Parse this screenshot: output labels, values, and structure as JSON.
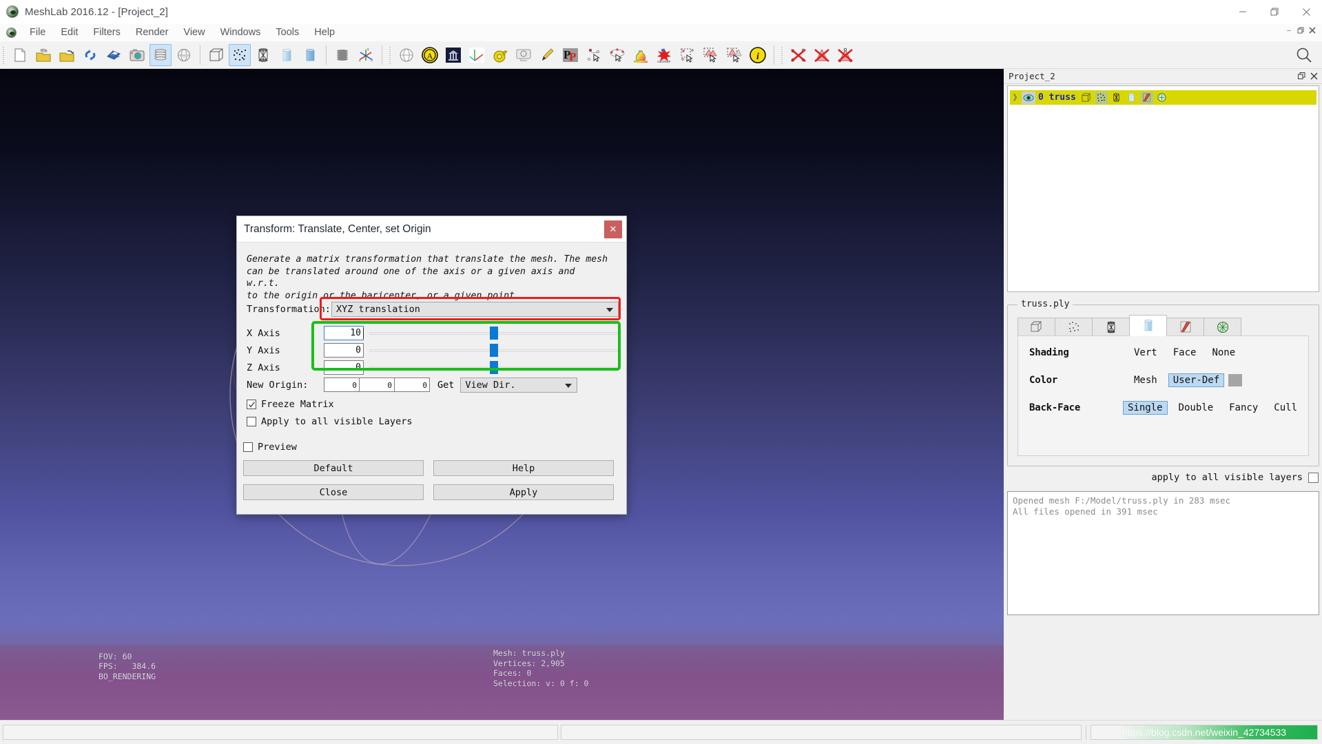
{
  "window": {
    "title": "MeshLab 2016.12 - [Project_2]",
    "logo_icon": "meshlab-logo-icon",
    "controls": [
      {
        "name": "minimize-button",
        "label": "—"
      },
      {
        "name": "restore-button",
        "label": "❐"
      },
      {
        "name": "close-button",
        "label": "✕"
      }
    ],
    "mdi_controls": [
      {
        "name": "mdi-minimize-button",
        "label": "–"
      },
      {
        "name": "mdi-restore-button",
        "label": "❐"
      },
      {
        "name": "mdi-close-button",
        "label": "✕"
      }
    ]
  },
  "menubar": {
    "items": [
      "File",
      "Edit",
      "Filters",
      "Render",
      "View",
      "Windows",
      "Tools",
      "Help"
    ]
  },
  "toolbar": {
    "groups": [
      {
        "name": "file-group",
        "buttons": [
          {
            "name": "new-project-icon",
            "checked": false
          },
          {
            "name": "open-project-icon",
            "checked": false
          },
          {
            "name": "open-mesh-icon",
            "checked": false
          },
          {
            "name": "reload-icon",
            "checked": false
          },
          {
            "name": "save-mesh-icon",
            "checked": false
          },
          {
            "name": "snapshot-icon",
            "checked": false
          },
          {
            "name": "show-layer-dialog-icon",
            "checked": true
          },
          {
            "name": "show-raster-layer-icon",
            "checked": false
          }
        ]
      },
      {
        "name": "render-group",
        "buttons": [
          {
            "name": "bounding-box-icon",
            "checked": false
          },
          {
            "name": "points-icon",
            "checked": true
          },
          {
            "name": "wireframe-icon",
            "checked": false
          },
          {
            "name": "flat-lines-icon",
            "checked": false
          },
          {
            "name": "smooth-icon",
            "checked": false
          },
          {
            "name": "texture-icon",
            "checked": false
          },
          {
            "name": "show-axis-icon",
            "checked": false
          }
        ]
      },
      {
        "name": "edit-group",
        "buttons": [
          {
            "name": "sphere-edit-icon",
            "checked": false
          },
          {
            "name": "align-icon",
            "checked": false
          },
          {
            "name": "z-painting-icon",
            "checked": false
          },
          {
            "name": "manipulators-icon",
            "checked": false
          },
          {
            "name": "measure-tool-icon",
            "checked": false
          },
          {
            "name": "raster-alignment-icon",
            "checked": false
          },
          {
            "name": "paint-brush-icon",
            "checked": false
          },
          {
            "name": "pick-points-icon",
            "checked": false
          },
          {
            "name": "select-vertexes-icon",
            "checked": false
          },
          {
            "name": "quality-mapper-icon",
            "checked": false
          },
          {
            "name": "georef-icon",
            "checked": false
          },
          {
            "name": "select-vertex-rubber-icon",
            "checked": false
          },
          {
            "name": "select-faces-icon",
            "checked": false
          },
          {
            "name": "select-connected-icon",
            "checked": false
          },
          {
            "name": "get-info-icon",
            "checked": false
          }
        ]
      },
      {
        "name": "delete-group",
        "buttons": [
          {
            "name": "delete-vertices-icon",
            "checked": false
          },
          {
            "name": "delete-faces-icon",
            "checked": false
          },
          {
            "name": "delete-faces-and-vertices-icon",
            "checked": false
          }
        ]
      }
    ],
    "search_icon": "search-icon"
  },
  "viewport": {
    "osd_left": "FOV: 60\nFPS:   384.6\nBO_RENDERING",
    "osd_mid": "Mesh: truss.ply\nVertices: 2,905\nFaces: 0\nSelection: v: 0 f: 0",
    "trackball_color": "#c9a8c4"
  },
  "dock": {
    "project_panel": {
      "title": "Project_2",
      "float_icon": "float-panel-icon",
      "close_icon": "close-panel-icon",
      "layers": [
        {
          "expand_icon": "chevron-right-icon",
          "visibility_icon": "eye-icon",
          "name": "0 truss",
          "icons": [
            {
              "name": "bounding-box-icon",
              "selected": false
            },
            {
              "name": "points-icon",
              "selected": true
            },
            {
              "name": "wireframe-icon",
              "selected": false
            },
            {
              "name": "flat-lines-icon",
              "selected": false
            },
            {
              "name": "smooth-icon",
              "selected": true
            },
            {
              "name": "texture-icon",
              "selected": false
            }
          ]
        }
      ]
    },
    "render_panel": {
      "group_label": "truss.ply",
      "tabs": [
        {
          "name": "tab-bounding-box",
          "icon": "bounding-box-icon",
          "active": false
        },
        {
          "name": "tab-points",
          "icon": "points-icon",
          "active": false
        },
        {
          "name": "tab-wireframe",
          "icon": "wireframe-icon",
          "active": false
        },
        {
          "name": "tab-solid",
          "icon": "smooth-cylinder-icon",
          "active": true
        },
        {
          "name": "tab-flat-lines",
          "icon": "flat-lines-icon",
          "active": false
        },
        {
          "name": "tab-texture",
          "icon": "texture-icon",
          "active": false
        }
      ],
      "rows": [
        {
          "label": "Shading",
          "options": [
            {
              "text": "Vert",
              "selected": false
            },
            {
              "text": "Face",
              "selected": false
            },
            {
              "text": "None",
              "selected": false
            }
          ]
        },
        {
          "label": "Color",
          "options": [
            {
              "text": "Mesh",
              "selected": false
            },
            {
              "text": "User-Def",
              "selected": true
            }
          ],
          "swatch": "#a5a5a5"
        },
        {
          "label": "Back-Face",
          "options": [
            {
              "text": "Single",
              "selected": true
            },
            {
              "text": "Double",
              "selected": false
            },
            {
              "text": "Fancy",
              "selected": false
            },
            {
              "text": "Cull",
              "selected": false
            }
          ]
        }
      ],
      "apply_all_label": "apply to all visible layers",
      "apply_all_checked": false
    },
    "log": "Opened mesh F:/Model/truss.ply in 283 msec\nAll files opened in 391 msec"
  },
  "dialog": {
    "title": "Transform: Translate, Center, set Origin",
    "close_label": "✕",
    "description": "Generate a matrix transformation that translate the mesh. The mesh\ncan be translated around one of the axis or a given axis and w.r.t.\nto the origin or the baricenter, or a given point.",
    "transformation": {
      "label": "Transformation:",
      "value": "XYZ translation"
    },
    "axes": [
      {
        "label": "X Axis",
        "value": "10",
        "slider_pct": 50,
        "focused": true
      },
      {
        "label": "Y Axis",
        "value": "0",
        "slider_pct": 50,
        "focused": false
      },
      {
        "label": "Z Axis",
        "value": "0",
        "slider_pct": 50,
        "focused": false
      }
    ],
    "new_origin": {
      "label": "New Origin:",
      "values": [
        "0",
        "0",
        "0"
      ],
      "get_label": "Get",
      "get_value": "View Dir."
    },
    "checkboxes": [
      {
        "name": "freeze-matrix-checkbox",
        "label": "Freeze Matrix",
        "checked": true
      },
      {
        "name": "apply-all-visible-layers-checkbox",
        "label": "Apply to all visible Layers",
        "checked": false
      },
      {
        "name": "preview-checkbox",
        "label": "Preview",
        "checked": false
      }
    ],
    "buttons": [
      {
        "name": "default-button",
        "label": "Default"
      },
      {
        "name": "help-button",
        "label": "Help"
      },
      {
        "name": "close-button",
        "label": "Close"
      },
      {
        "name": "apply-button",
        "label": "Apply"
      }
    ],
    "highlights": [
      {
        "name": "red-highlight",
        "color": "#ef1b1b"
      },
      {
        "name": "green-highlight",
        "color": "#18c018"
      }
    ]
  },
  "statusbar": {
    "watermark": "https://blog.csdn.net/weixin_42734533"
  }
}
